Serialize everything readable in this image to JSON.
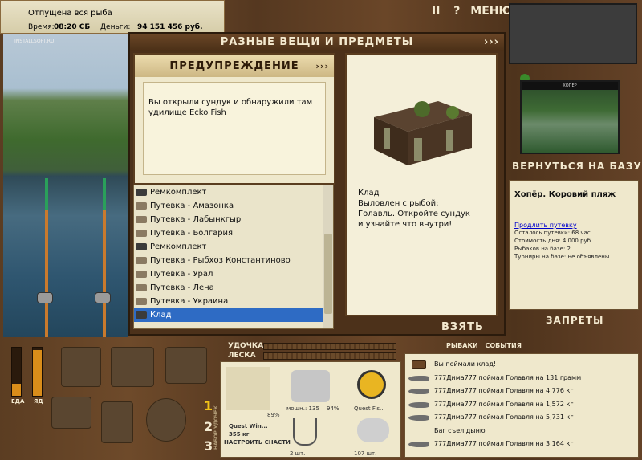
{
  "status": {
    "message": "Отпущена вся рыба",
    "time_label": "Время:",
    "time_value": "08:20 СБ",
    "money_label": "Деньги:",
    "money_value": "94 151 456 руб."
  },
  "top_menu": {
    "pause": "II",
    "help": "?",
    "menu": "МЕНЮ"
  },
  "watermark": "INSTALLSOFT.RU",
  "dialog": {
    "title": "РАЗНЫЕ ВЕЩИ И ПРЕДМЕТЫ",
    "arrows": "›››",
    "warning": {
      "title": "ПРЕДУПРЕЖДЕНИЕ",
      "arrows": "›››",
      "text": "Вы открыли сундук и обнаружили там удилище Ecko Fish"
    },
    "items": [
      {
        "label": "Ремкомплект",
        "kind": "box"
      },
      {
        "label": "Путевка - Амазонка",
        "kind": "ticket"
      },
      {
        "label": "Путевка - Лабынкгыр",
        "kind": "ticket"
      },
      {
        "label": "Путевка - Болгария",
        "kind": "ticket"
      },
      {
        "label": "Ремкомплект",
        "kind": "box"
      },
      {
        "label": "Путевка - Рыбхоз Константиново",
        "kind": "ticket"
      },
      {
        "label": "Путевка - Урал",
        "kind": "ticket"
      },
      {
        "label": "Путевка - Лена",
        "kind": "ticket"
      },
      {
        "label": "Путевка - Украина",
        "kind": "ticket"
      },
      {
        "label": "Клад",
        "kind": "box",
        "selected": true
      }
    ],
    "detail_text": "Клад\nВыловлен с рыбой:\nГолавль. Откройте сундук\nи узнайте что внутри!",
    "take_button": "ВЗЯТЬ"
  },
  "right": {
    "photo_caption": "ХОПЁР",
    "back_to_base": "ВЕРНУТЬСЯ НА БАЗУ",
    "base_name": "Хопёр. Коровий пляж",
    "extend_link": "Продлить путевку",
    "lines": [
      "Осталось путевки: 68 час.",
      "Стоимость дня: 4 000 руб.",
      "Рыбаков на базе: 2",
      "Турниры на базе: не объявлены"
    ],
    "bans": "ЗАПРЕТЫ"
  },
  "bottom": {
    "food_label": "ЕДА",
    "poison_label": "ЯД",
    "food_level": 0.25,
    "poison_level": 0.95,
    "rod_label": "УДОЧКА",
    "line_label": "ЛЕСКА",
    "tabs": [
      "РЫБАКИ",
      "СОБЫТИЯ"
    ],
    "slots": [
      "1",
      "2",
      "3"
    ],
    "side_label": "НАБОР УДОЧЕК",
    "tackle": {
      "rod_pct": "89%",
      "rod_name": "Quest Win...",
      "rod_len": "355 кг",
      "reel_label": "мощн.: 135",
      "reel_pct": "94%",
      "line_name": "Quest Fis...",
      "setup": "НАСТРОИТЬ СНАСТИ",
      "hooks": "2 шт.",
      "bait": "107 шт."
    },
    "events": [
      {
        "text": "Вы поймали клад!",
        "icon": "chest"
      },
      {
        "text": "777Дима777 поймал Голавля на 131 грамм",
        "icon": "fish"
      },
      {
        "text": "777Дима777 поймал Голавля на 4,776 кг",
        "icon": "fish"
      },
      {
        "text": "777Дима777 поймал Голавля на 1,572 кг",
        "icon": "fish"
      },
      {
        "text": "777Дима777 поймал Голавля на 5,731 кг",
        "icon": "fish"
      },
      {
        "text": "Баг съел дыню",
        "icon": "none"
      },
      {
        "text": "777Дима777 поймал Голавля на 3,164 кг",
        "icon": "fish"
      }
    ]
  }
}
